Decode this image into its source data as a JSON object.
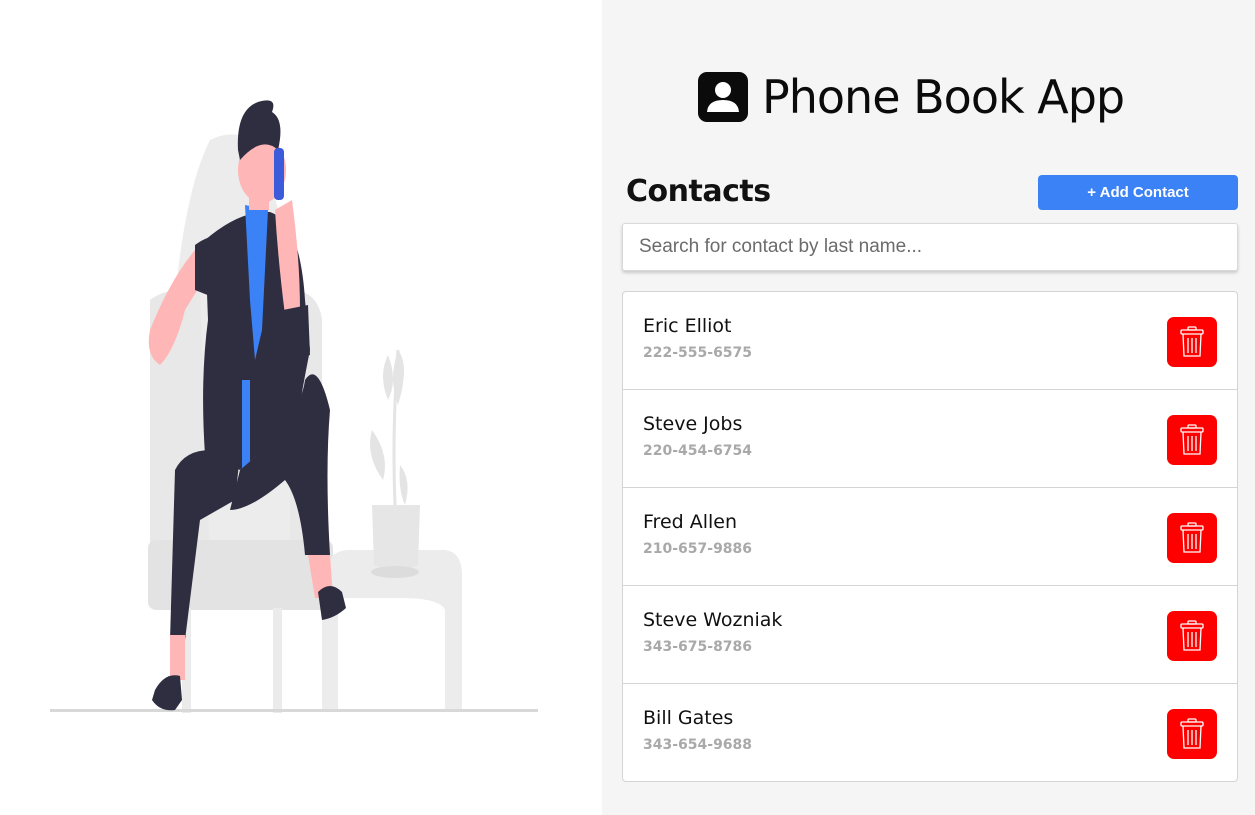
{
  "app": {
    "title": "Phone Book App",
    "icon": "contact-card-icon"
  },
  "contacts_section": {
    "heading": "Contacts",
    "add_button_label": "+ Add Contact"
  },
  "search": {
    "placeholder": "Search for contact by last name...",
    "value": ""
  },
  "contacts": [
    {
      "name": "Eric Elliot",
      "phone": "222-555-6575"
    },
    {
      "name": "Steve Jobs",
      "phone": "220-454-6754"
    },
    {
      "name": "Fred Allen",
      "phone": "210-657-9886"
    },
    {
      "name": "Steve Wozniak",
      "phone": "343-675-8786"
    },
    {
      "name": "Bill Gates",
      "phone": "343-654-9688"
    }
  ],
  "icons": {
    "delete": "trash-icon",
    "illustration": "person-on-phone-illustration"
  },
  "colors": {
    "accent": "#3b82f6",
    "danger": "#ff0000",
    "panel_bg": "#f5f5f5",
    "phone_text": "#a9a9a9"
  }
}
